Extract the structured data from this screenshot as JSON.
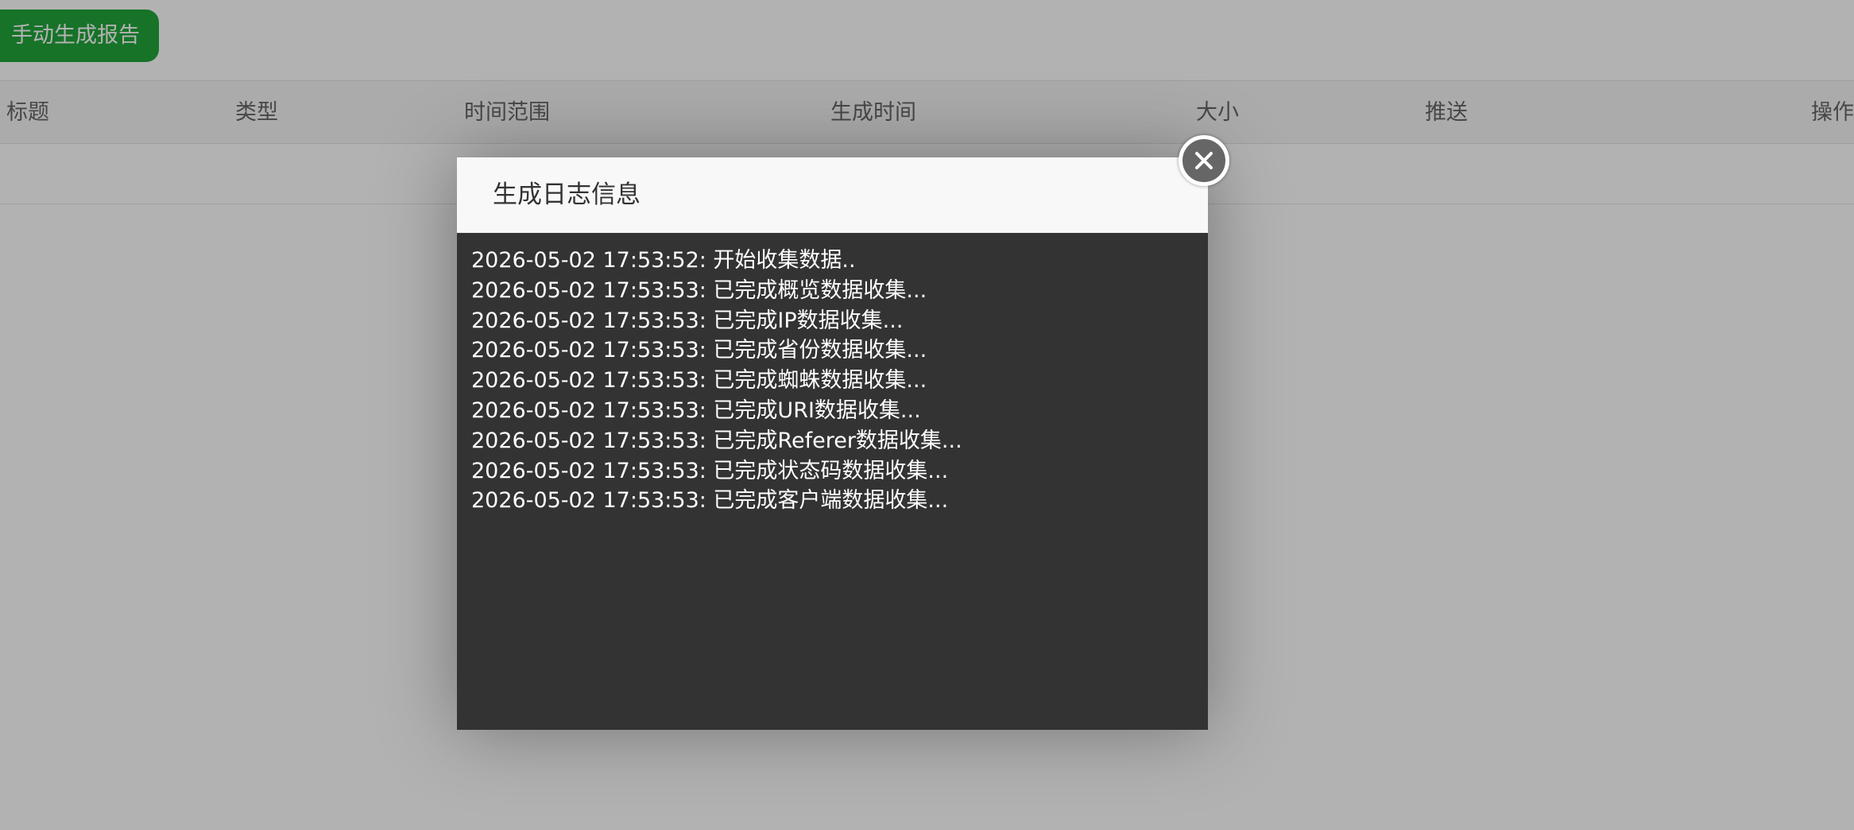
{
  "toolbar": {
    "generate_label": "手动生成报告"
  },
  "table": {
    "columns": [
      "标题",
      "类型",
      "时间范围",
      "生成时间",
      "大小",
      "推送",
      "操作"
    ]
  },
  "dialog": {
    "title": "生成日志信息",
    "close_icon": "close-icon",
    "log_lines": [
      "2026-05-02 17:53:52: 开始收集数据..",
      "2026-05-02 17:53:53: 已完成概览数据收集...",
      "2026-05-02 17:53:53: 已完成IP数据收集...",
      "2026-05-02 17:53:53: 已完成省份数据收集...",
      "2026-05-02 17:53:53: 已完成蜘蛛数据收集...",
      "2026-05-02 17:53:53: 已完成URI数据收集...",
      "2026-05-02 17:53:53: 已完成Referer数据收集...",
      "2026-05-02 17:53:53: 已完成状态码数据收集...",
      "2026-05-02 17:53:53: 已完成客户端数据收集..."
    ]
  },
  "colors": {
    "primary_button": "#20a53a",
    "log_background": "#333333",
    "log_text": "#ffffff"
  }
}
